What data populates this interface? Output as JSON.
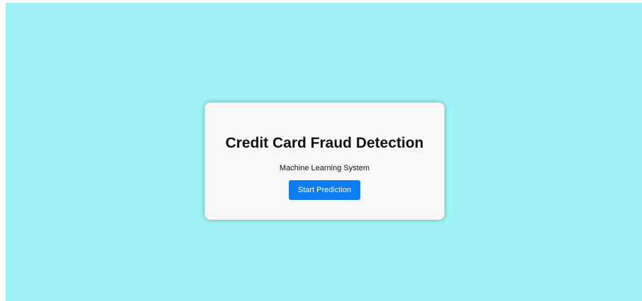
{
  "card": {
    "title": "Credit Card Fraud Detection",
    "subtitle": "Machine Learning System",
    "button_label": "Start Prediction"
  },
  "colors": {
    "page_background": "#a1f2f4",
    "card_background": "#f8f8f8",
    "button_background": "#0d7cf2",
    "button_text": "#ffffff",
    "text": "#111111"
  }
}
